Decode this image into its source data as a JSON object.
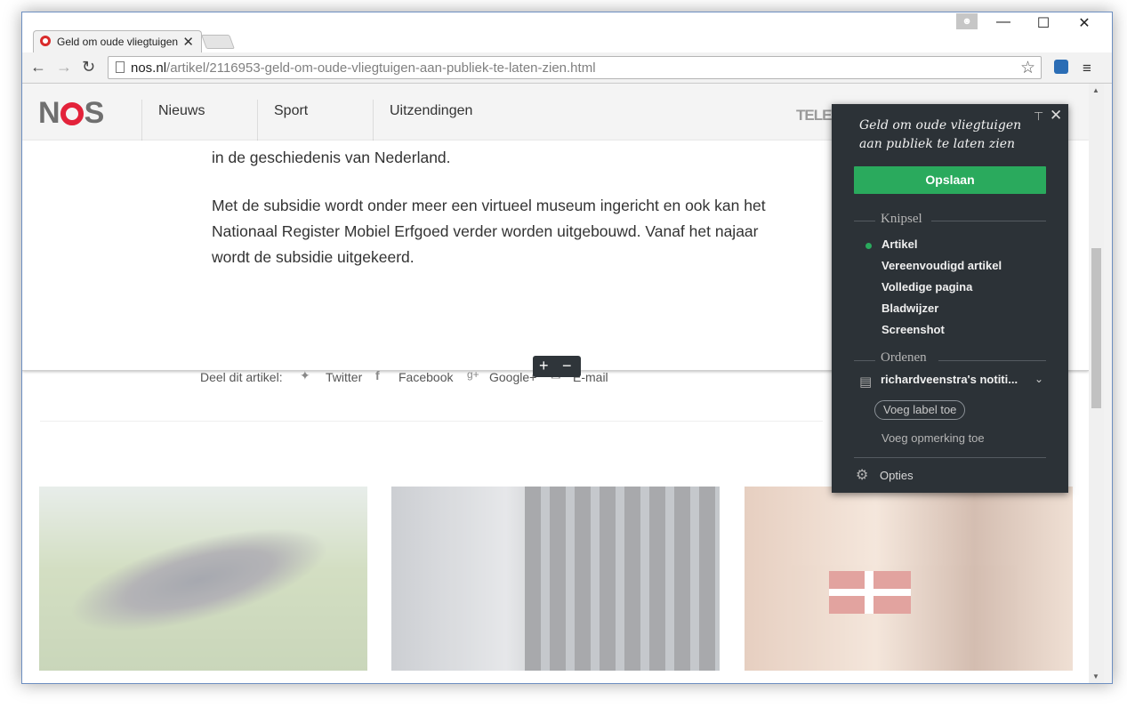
{
  "browser": {
    "tab_title": "Geld om oude vliegtuigen",
    "tab_close": "✕",
    "url_host": "nos.nl",
    "url_path": "/artikel/2116953-geld-om-oude-vliegtuigen-aan-publiek-te-laten-zien.html",
    "window_controls": {
      "minimize": "—",
      "maximize": "☐",
      "close": "✕"
    },
    "nav": {
      "back": "←",
      "forward": "→",
      "reload": "↻"
    },
    "bookmark_star": "☆",
    "menu_icon": "≡"
  },
  "site": {
    "logo_n": "N",
    "logo_s": "S",
    "nav": [
      "Nieuws",
      "Sport",
      "Uitzendingen"
    ],
    "teletext_partial": "TELE"
  },
  "article": {
    "line_partial": "in de geschiedenis van Nederland.",
    "paragraph": "Met de subsidie wordt onder meer een virtueel museum ingericht en ook kan het Nationaal Register Mobiel Erfgoed verder worden uitgebouwd. Vanaf het najaar wordt de subsidie uitgekeerd.",
    "share_label": "Deel dit artikel:",
    "share": [
      "Twitter",
      "Facebook",
      "Google+",
      "E-mail"
    ]
  },
  "zoom": {
    "plus": "+",
    "minus": "−"
  },
  "clipper": {
    "title": "Geld om oude vliegtuigen aan publiek te laten zien",
    "save_button": "Opslaan",
    "section_clip": "Knipsel",
    "clip_options": [
      "Artikel",
      "Vereenvoudigd artikel",
      "Volledige pagina",
      "Bladwijzer",
      "Screenshot"
    ],
    "selected_option": "Artikel",
    "section_organize": "Ordenen",
    "notebook": "richardveenstra's notiti...",
    "add_tag": "Voeg label toe",
    "add_note": "Voeg opmerking toe",
    "options": "Opties"
  },
  "colors": {
    "nos_red": "#e3223a",
    "save_green": "#2aaa5d",
    "panel_bg": "#2c3237"
  }
}
